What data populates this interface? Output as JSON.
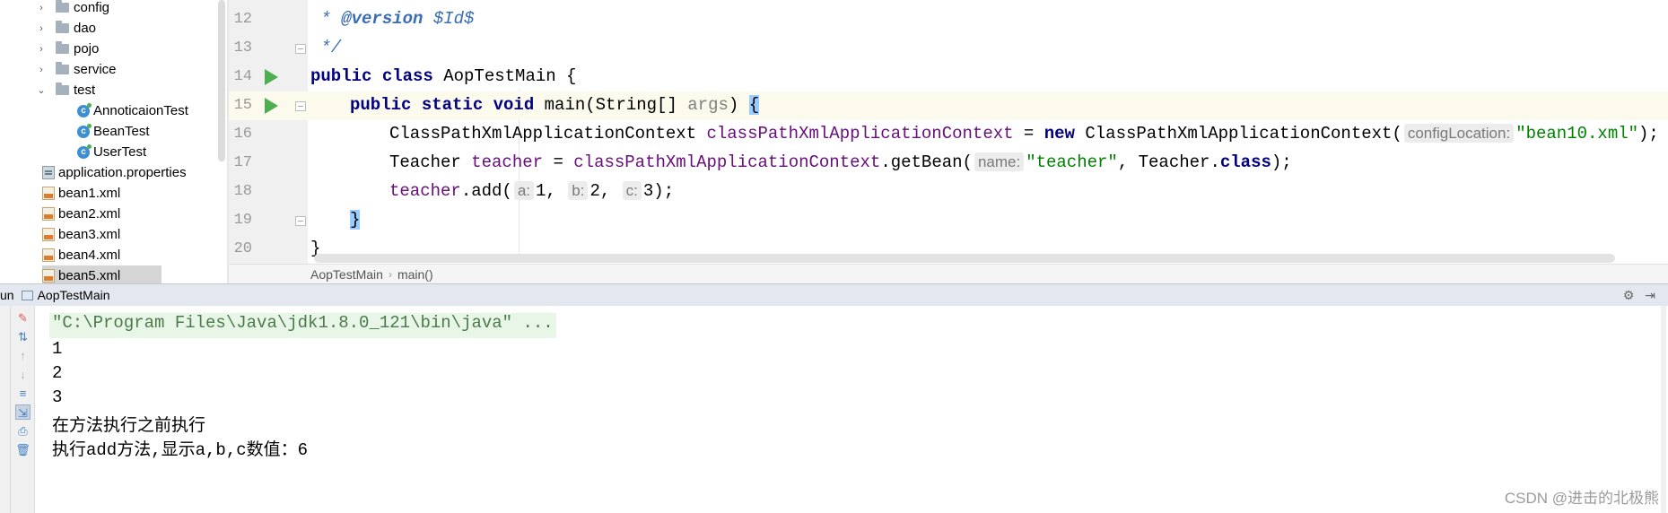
{
  "project_tree": {
    "items": [
      {
        "label": "config",
        "kind": "folder",
        "arrow": "›"
      },
      {
        "label": "dao",
        "kind": "folder",
        "arrow": "›"
      },
      {
        "label": "pojo",
        "kind": "folder",
        "arrow": "›"
      },
      {
        "label": "service",
        "kind": "folder",
        "arrow": "›"
      },
      {
        "label": "test",
        "kind": "folder",
        "arrow": "⌄"
      },
      {
        "label": "AnnoticaionTest",
        "kind": "class"
      },
      {
        "label": "BeanTest",
        "kind": "class"
      },
      {
        "label": "UserTest",
        "kind": "class"
      },
      {
        "label": "application.properties",
        "kind": "properties"
      },
      {
        "label": "bean1.xml",
        "kind": "xml"
      },
      {
        "label": "bean2.xml",
        "kind": "xml"
      },
      {
        "label": "bean3.xml",
        "kind": "xml"
      },
      {
        "label": "bean4.xml",
        "kind": "xml"
      },
      {
        "label": "bean5.xml",
        "kind": "xml"
      }
    ],
    "class_icon_letter": "c"
  },
  "editor": {
    "line_numbers": [
      "12",
      "13",
      "14",
      "15",
      "16",
      "17",
      "18",
      "19",
      "20"
    ],
    "lines": {
      "l12": {
        "prefix": " * ",
        "tag": "@version",
        "rest": " $Id$"
      },
      "l13": {
        "text": " */"
      },
      "l14": {
        "kw": "public class",
        "rest": " AopTestMain {"
      },
      "l15": {
        "kw": "public static void",
        "rest": " main(String[] ",
        "param": "args",
        "close": ") ",
        "brace": "{"
      },
      "l16": {
        "type": "ClassPathXmlApplicationContext ",
        "var": "classPathXmlApplicationContext",
        "eq": " = ",
        "kw_new": "new",
        "ctor": " ClassPathXmlApplicationContext(",
        "hint": "configLocation:",
        "str": "\"bean10.xml\"",
        "end": ");"
      },
      "l17": {
        "type": "Teacher ",
        "var": "teacher",
        "eq": " = ",
        "var2": "classPathXmlApplicationContext",
        "call": ".getBean(",
        "hint": "name:",
        "str": "\"teacher\"",
        "mid": ", Teacher.",
        "kw_class": "class",
        "end": ");"
      },
      "l18": {
        "var": "teacher",
        "call": ".add(",
        "hint_a": "a:",
        "v1": "1, ",
        "hint_b": "b:",
        "v2": "2, ",
        "hint_c": "c:",
        "v3": "3);"
      },
      "l19": {
        "brace": "}"
      },
      "l20": {
        "text": "}"
      }
    }
  },
  "breadcrumb": {
    "class": "AopTestMain",
    "separator": "›",
    "method": "main()"
  },
  "run_window": {
    "tab_prefix": "un",
    "title": "AopTestMain",
    "settings_icon": "⚙",
    "hide_icon": "⇥"
  },
  "console": {
    "lines": [
      "\"C:\\Program Files\\Java\\jdk1.8.0_121\\bin\\java\" ...",
      "1",
      "2",
      "3",
      "在方法执行之前执行",
      "执行add方法,显示a,b,c数值：6"
    ]
  },
  "watermark": "CSDN @进击的北极熊",
  "colors": {
    "keyword": "#000080",
    "doc_comment": "#3a6db3",
    "variable": "#660e7a",
    "string": "#008000",
    "run_green": "#4caf50"
  }
}
